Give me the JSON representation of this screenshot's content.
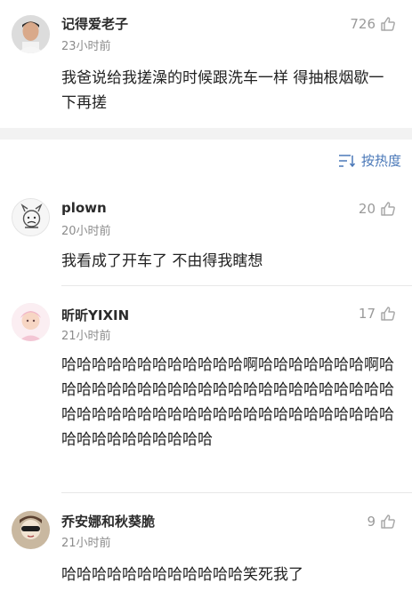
{
  "comments": [
    {
      "username": "记得爱老子",
      "time": "23小时前",
      "likes": "726",
      "text": "我爸说给我搓澡的时候跟洗车一样 得抽根烟歇一下再搓"
    },
    {
      "username": "plown",
      "time": "20小时前",
      "likes": "20",
      "text": "我看成了开车了 不由得我瞎想"
    },
    {
      "username": "昕昕YIXIN",
      "time": "21小时前",
      "likes": "17",
      "text": "哈哈哈哈哈哈哈哈哈哈哈哈啊哈哈哈哈哈哈哈啊哈哈哈哈哈哈哈哈哈哈哈哈哈哈哈哈哈哈哈哈哈哈哈哈哈哈哈哈哈哈哈哈哈哈哈哈哈哈哈哈哈哈哈哈哈哈哈哈哈哈哈哈哈哈哈"
    },
    {
      "username": "乔安娜和秋葵脆",
      "time": "21小时前",
      "likes": "9",
      "text": "哈哈哈哈哈哈哈哈哈哈哈哈笑死我了"
    }
  ],
  "sort": {
    "label": "按热度"
  },
  "colors": {
    "accent": "#4a78b8",
    "secondary_text": "#8c8c8c",
    "band": "#f2f2f2"
  },
  "icons": {
    "like": "thumbs-up-icon",
    "sort": "sort-lines-icon"
  }
}
